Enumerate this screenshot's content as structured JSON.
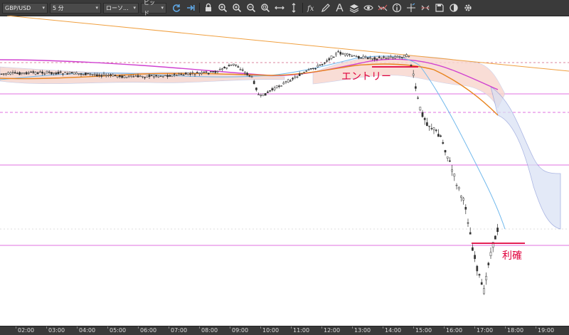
{
  "toolbar": {
    "symbol": "GBP/USD",
    "timeframe": "5 分",
    "chart_type": "ローソ...",
    "price_side": "ビッド",
    "icons": [
      "refresh-icon",
      "scroll-icon",
      "lock-icon",
      "zoom-in-icon",
      "zoom-in-alt-icon",
      "zoom-out-icon",
      "zoom-fit-icon",
      "horizontal-fit-icon",
      "vertical-fit-icon",
      "fx-indicator-icon",
      "pen-icon",
      "text-icon",
      "layers-icon",
      "eye-icon",
      "compare-icon",
      "info-icon",
      "crosshair-icon",
      "trade-icon",
      "save-icon",
      "theme-icon",
      "settings-icon"
    ]
  },
  "annotations": {
    "entry": "エントリー",
    "take_profit": "利確"
  },
  "colors": {
    "candle": "#333333",
    "entry_text": "#e0003c",
    "trendline": "#f0a040",
    "magenta": "#d040d0",
    "hline": "#e060e0",
    "ma_blue": "#60b0e8",
    "ma_orange": "#e88020",
    "kumo": "#c8d4f0",
    "kumo_edge": "#8090d8"
  },
  "time_axis": [
    "02:00",
    "03:00",
    "04:00",
    "05:00",
    "06:00",
    "07:00",
    "08:00",
    "09:00",
    "10:00",
    "11:00",
    "12:00",
    "13:00",
    "14:00",
    "15:00",
    "16:00",
    "17:00",
    "18:00",
    "19:00"
  ]
}
